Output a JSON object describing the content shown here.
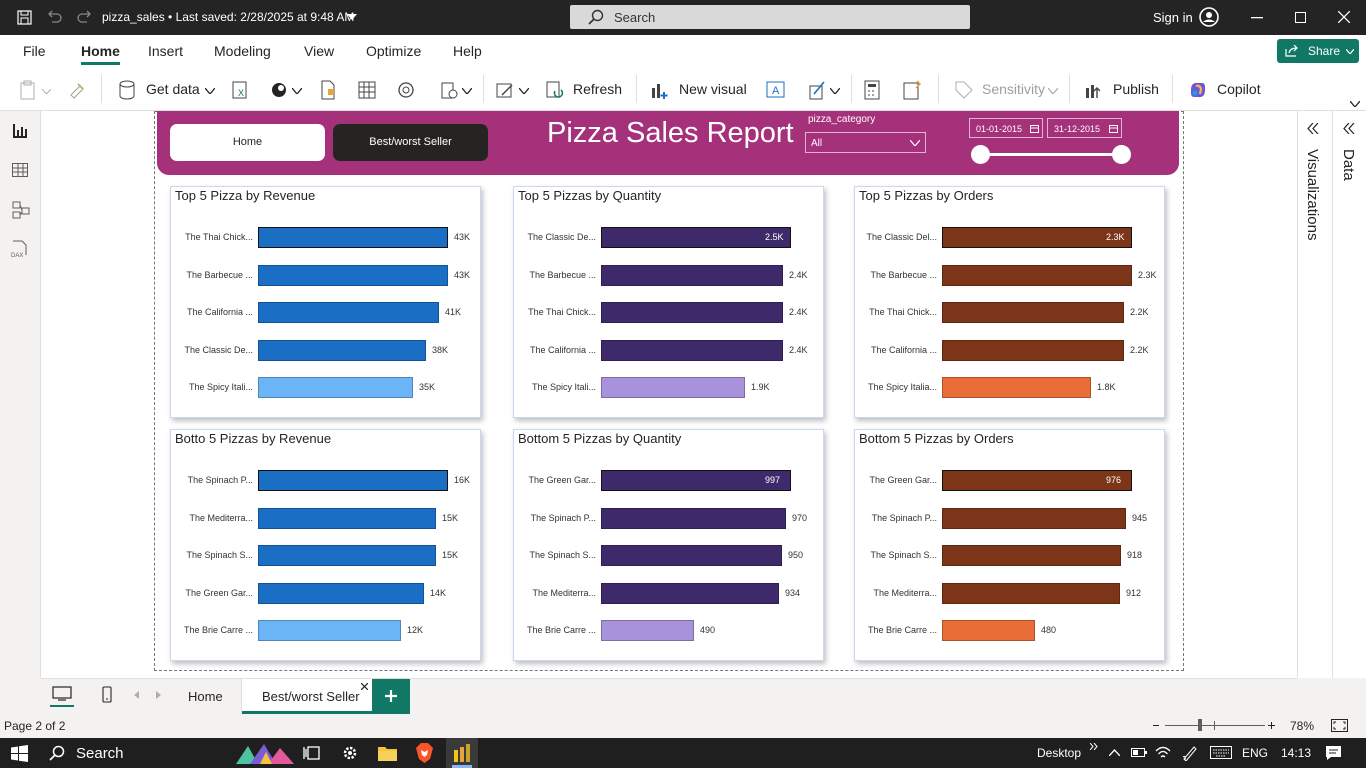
{
  "titlebar": {
    "doc_title": "pizza_sales • Last saved: 2/28/2025 at 9:48 AM",
    "search_placeholder": "Search",
    "sign_in": "Sign in"
  },
  "menu": {
    "items": [
      "File",
      "Home",
      "Insert",
      "Modeling",
      "View",
      "Optimize",
      "Help"
    ],
    "active": "Home",
    "share_label": "Share"
  },
  "ribbon": {
    "get_data": "Get data",
    "refresh": "Refresh",
    "new_visual": "New visual",
    "sensitivity": "Sensitivity",
    "publish": "Publish",
    "copilot": "Copilot"
  },
  "report": {
    "title": "Pizza Sales Report",
    "nav_home": "Home",
    "nav_bestworst": "Best/worst Seller",
    "slicer_label": "pizza_category",
    "slicer_value": "All",
    "date_start": "01-01-2015",
    "date_end": "31-12-2015"
  },
  "colors": {
    "header": "#a5317a",
    "blue": "#1a6fc4",
    "purple": "#3e2a6b",
    "brown": "#7c3519",
    "accent": "#117865"
  },
  "chart_data": [
    {
      "type": "bar",
      "title": "Top 5 Pizza by Revenue",
      "categories": [
        "The Thai Chick...",
        "The Barbecue ...",
        "The California ...",
        "The Classic De...",
        "The Spicy Itali..."
      ],
      "values": [
        43,
        43,
        41,
        38,
        35
      ],
      "labels": [
        "43K",
        "43K",
        "41K",
        "38K",
        "35K"
      ]
    },
    {
      "type": "bar",
      "title": "Top 5 Pizzas by Quantity",
      "categories": [
        "The Classic De...",
        "The Barbecue ...",
        "The Thai Chick...",
        "The California ...",
        "The Spicy Itali..."
      ],
      "values": [
        2.5,
        2.4,
        2.4,
        2.4,
        1.9
      ],
      "labels": [
        "2.5K",
        "2.4K",
        "2.4K",
        "2.4K",
        "1.9K"
      ]
    },
    {
      "type": "bar",
      "title": "Top 5 Pizzas by Orders",
      "categories": [
        "The Classic Del...",
        "The Barbecue ...",
        "The Thai Chick...",
        "The California ...",
        "The Spicy Italia..."
      ],
      "values": [
        2.3,
        2.3,
        2.2,
        2.2,
        1.8
      ],
      "labels": [
        "2.3K",
        "2.3K",
        "2.2K",
        "2.2K",
        "1.8K"
      ]
    },
    {
      "type": "bar",
      "title": "Botto 5 Pizzas by Revenue",
      "categories": [
        "The Spinach P...",
        "The Mediterra...",
        "The Spinach S...",
        "The Green Gar...",
        "The Brie Carre ..."
      ],
      "values": [
        16,
        15,
        15,
        14,
        12
      ],
      "labels": [
        "16K",
        "15K",
        "15K",
        "14K",
        "12K"
      ]
    },
    {
      "type": "bar",
      "title": "Bottom 5 Pizzas by Quantity",
      "categories": [
        "The Green Gar...",
        "The Spinach P...",
        "The Spinach S...",
        "The Mediterra...",
        "The Brie Carre ..."
      ],
      "values": [
        997,
        970,
        950,
        934,
        490
      ],
      "labels": [
        "997",
        "970",
        "950",
        "934",
        "490"
      ]
    },
    {
      "type": "bar",
      "title": "Bottom 5 Pizzas by Orders",
      "categories": [
        "The Green Gar...",
        "The Spinach P...",
        "The Spinach S...",
        "The Mediterra...",
        "The Brie Carre ..."
      ],
      "values": [
        976,
        945,
        918,
        912,
        480
      ],
      "labels": [
        "976",
        "945",
        "918",
        "912",
        "480"
      ]
    }
  ],
  "right_pane": {
    "visualizations": "Visualizations",
    "data": "Data"
  },
  "tabs": {
    "home": "Home",
    "bestworst": "Best/worst Seller"
  },
  "status": {
    "page": "Page 2 of 2",
    "zoom": "78%"
  },
  "taskbar": {
    "search": "Search",
    "desktop": "Desktop",
    "lang": "ENG",
    "time": "14:13"
  }
}
